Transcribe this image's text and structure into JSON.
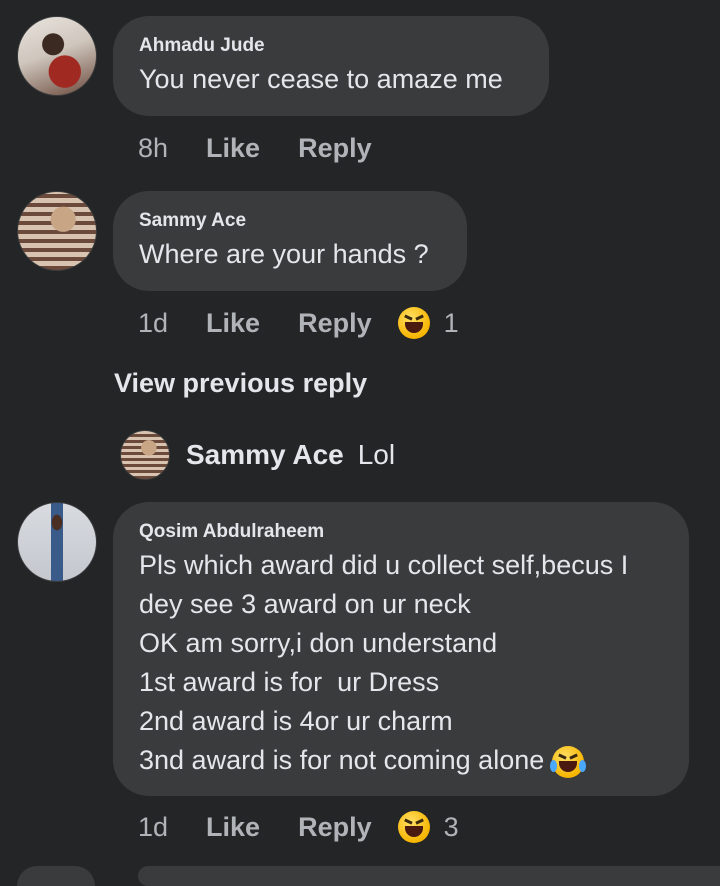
{
  "comments": [
    {
      "author": "Ahmadu Jude",
      "lines": [
        "You never cease to amaze me"
      ],
      "time": "8h",
      "like": "Like",
      "reply": "Reply"
    },
    {
      "author": "Sammy Ace",
      "lines": [
        "Where are your hands ?"
      ],
      "time": "1d",
      "like": "Like",
      "reply": "Reply",
      "reaction": {
        "icon": "laughing-emoji-icon",
        "count": "1"
      }
    },
    {
      "author": "Qosim Abdulraheem",
      "lines": [
        "Pls which award did u collect self,becus I",
        "dey see 3 award on ur neck",
        "OK am sorry,i don understand",
        "1st award is for  ur Dress",
        "2nd award is 4or ur charm",
        "3nd award is for not coming alone"
      ],
      "trailing_emoji": "tears-of-joy-emoji-icon",
      "time": "1d",
      "like": "Like",
      "reply": "Reply",
      "reaction": {
        "icon": "laughing-emoji-icon",
        "count": "3"
      }
    }
  ],
  "view_previous_reply": "View previous reply",
  "collapsed_reply": {
    "author": "Sammy Ace",
    "text": "Lol"
  },
  "colors": {
    "background": "#242526",
    "bubble": "#3a3b3c",
    "text": "#e4e6eb",
    "muted": "#b0b3b8"
  }
}
